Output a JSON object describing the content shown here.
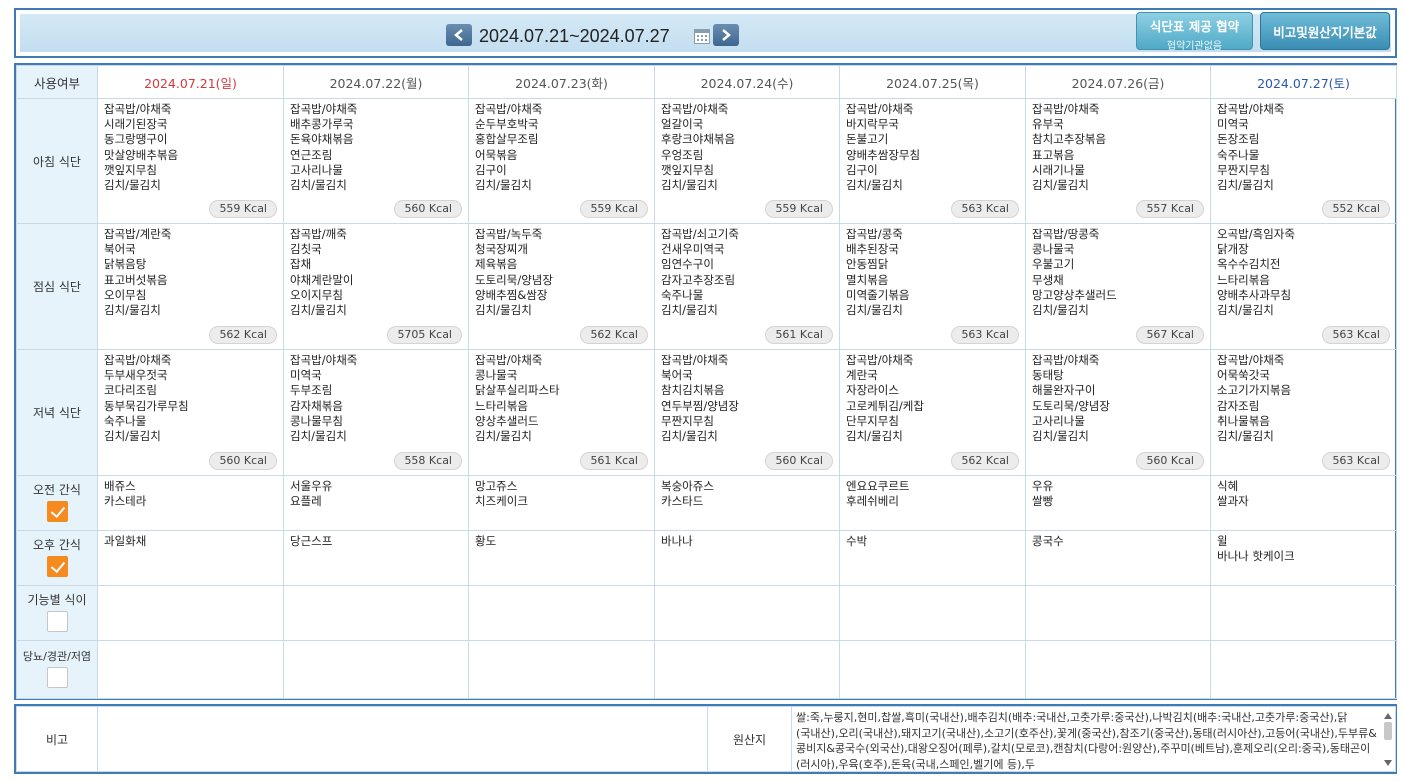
{
  "header": {
    "date_range": "2024.07.21~2024.07.27",
    "prev_label": "<",
    "next_label": ">",
    "provide_button": {
      "line1": "식단표 제공 협약",
      "line2": "협약기관없음"
    },
    "remarks_button": "비고및원산지기본값"
  },
  "table": {
    "corner_label": "사용여부",
    "days": [
      {
        "label": "2024.07.21(일)",
        "kind": "sun"
      },
      {
        "label": "2024.07.22(월)",
        "kind": "weekday"
      },
      {
        "label": "2024.07.23(화)",
        "kind": "weekday"
      },
      {
        "label": "2024.07.24(수)",
        "kind": "weekday"
      },
      {
        "label": "2024.07.25(목)",
        "kind": "weekday"
      },
      {
        "label": "2024.07.26(금)",
        "kind": "weekday"
      },
      {
        "label": "2024.07.27(토)",
        "kind": "sat"
      }
    ],
    "rows": [
      {
        "label": "아침 식단",
        "checkbox": null,
        "cells": [
          {
            "items": [
              "잡곡밥/야채죽",
              "시래기된장국",
              "동그랑땡구이",
              "맛살양배추볶음",
              "깻잎지무침",
              "김치/물김치"
            ],
            "kcal": "559 Kcal"
          },
          {
            "items": [
              "잡곡밥/야채죽",
              "배추콩가루국",
              "돈육야채볶음",
              "연근조림",
              "고사리나물",
              "김치/물김치"
            ],
            "kcal": "560 Kcal"
          },
          {
            "items": [
              "잡곡밥/야채죽",
              "순두부호박국",
              "홍합살무조림",
              "어묵볶음",
              "김구이",
              "김치/물김치"
            ],
            "kcal": "559 Kcal"
          },
          {
            "items": [
              "잡곡밥/야채죽",
              "얼갈이국",
              "후랑크야채볶음",
              "우엉조림",
              "깻잎지무침",
              "김치/물김치"
            ],
            "kcal": "559 Kcal"
          },
          {
            "items": [
              "잡곡밥/야채죽",
              "바지락무국",
              "돈불고기",
              "양배추쌈장무침",
              "김구이",
              "김치/물김치"
            ],
            "kcal": "563 Kcal"
          },
          {
            "items": [
              "잡곡밥/야채죽",
              "유부국",
              "참치고추장볶음",
              "표고볶음",
              "시래기나물",
              "김치/물김치"
            ],
            "kcal": "557 Kcal"
          },
          {
            "items": [
              "잡곡밥/야채죽",
              "미역국",
              "돈장조림",
              "숙주나물",
              "무짠지무침",
              "김치/물김치"
            ],
            "kcal": "552 Kcal"
          }
        ]
      },
      {
        "label": "점심 식단",
        "checkbox": null,
        "cells": [
          {
            "items": [
              "잡곡밥/계란죽",
              "북어국",
              "닭볶음탕",
              "표고버섯볶음",
              "오이무침",
              "김치/물김치"
            ],
            "kcal": "562 Kcal"
          },
          {
            "items": [
              "잡곡밥/깨죽",
              "김칫국",
              "잡채",
              "야채계란말이",
              "오이지무침",
              "김치/물김치"
            ],
            "kcal": "5705 Kcal"
          },
          {
            "items": [
              "잡곡밥/녹두죽",
              "청국장찌개",
              "제육볶음",
              "도토리묵/양념장",
              "양배추찜&쌈장",
              "김치/물김치"
            ],
            "kcal": "562 Kcal"
          },
          {
            "items": [
              "잡곡밥/쇠고기죽",
              "건새우미역국",
              "임연수구이",
              "감자고추장조림",
              "숙주나물",
              "김치/물김치"
            ],
            "kcal": "561 Kcal"
          },
          {
            "items": [
              "잡곡밥/콩죽",
              "배추된장국",
              "안동찜닭",
              "멸치볶음",
              "미역줄기볶음",
              "김치/물김치"
            ],
            "kcal": "563 Kcal"
          },
          {
            "items": [
              "잡곡밥/땅콩죽",
              "콩나물국",
              "우불고기",
              "무생채",
              "망고양상추샐러드",
              "김치/물김치"
            ],
            "kcal": "567 Kcal"
          },
          {
            "items": [
              "오곡밥/흑임자죽",
              "닭개장",
              "옥수수김치전",
              "느타리볶음",
              "양배추사과무침",
              "김치/물김치"
            ],
            "kcal": "563 Kcal"
          }
        ]
      },
      {
        "label": "저녁 식단",
        "checkbox": null,
        "cells": [
          {
            "items": [
              "잡곡밥/야채죽",
              "두부새우젓국",
              "코다리조림",
              "동부묵김가루무침",
              "숙주나물",
              "김치/물김치"
            ],
            "kcal": "560 Kcal"
          },
          {
            "items": [
              "잡곡밥/야채죽",
              "미역국",
              "두부조림",
              "감자채볶음",
              "콩나물무침",
              "김치/물김치"
            ],
            "kcal": "558 Kcal"
          },
          {
            "items": [
              "잡곡밥/야채죽",
              "콩나물국",
              "닭살푸실리파스타",
              "느타리볶음",
              "양상추샐러드",
              "김치/물김치"
            ],
            "kcal": "561 Kcal"
          },
          {
            "items": [
              "잡곡밥/야채죽",
              "북어국",
              "참치김치볶음",
              "연두부찜/양념장",
              "무짠지무침",
              "김치/물김치"
            ],
            "kcal": "560 Kcal"
          },
          {
            "items": [
              "잡곡밥/야채죽",
              "계란국",
              "자장라이스",
              "고로케튀김/케찹",
              "단무지무침",
              "김치/물김치"
            ],
            "kcal": "562 Kcal"
          },
          {
            "items": [
              "잡곡밥/야채죽",
              "동태탕",
              "해물완자구이",
              "도토리묵/양념장",
              "고사리나물",
              "김치/물김치"
            ],
            "kcal": "560 Kcal"
          },
          {
            "items": [
              "잡곡밥/야채죽",
              "어묵쑥갓국",
              "소고기가지볶음",
              "감자조림",
              "취나물볶음",
              "김치/물김치"
            ],
            "kcal": "563 Kcal"
          }
        ]
      },
      {
        "label": "오전 간식",
        "checkbox": true,
        "cells": [
          {
            "items": [
              "배쥬스",
              "카스테라"
            ],
            "kcal": ""
          },
          {
            "items": [
              "서울우유",
              "요플레"
            ],
            "kcal": ""
          },
          {
            "items": [
              "망고쥬스",
              "치즈케이크"
            ],
            "kcal": ""
          },
          {
            "items": [
              "복숭아쥬스",
              "카스타드"
            ],
            "kcal": ""
          },
          {
            "items": [
              "엔요요쿠르트",
              "후레쉬베리"
            ],
            "kcal": ""
          },
          {
            "items": [
              "우유",
              "쌀빵"
            ],
            "kcal": ""
          },
          {
            "items": [
              "식혜",
              "쌀과자"
            ],
            "kcal": ""
          }
        ]
      },
      {
        "label": "오후 간식",
        "checkbox": true,
        "cells": [
          {
            "items": [
              "과일화채"
            ],
            "kcal": ""
          },
          {
            "items": [
              "당근스프"
            ],
            "kcal": ""
          },
          {
            "items": [
              "황도"
            ],
            "kcal": ""
          },
          {
            "items": [
              "바나나"
            ],
            "kcal": ""
          },
          {
            "items": [
              "수박"
            ],
            "kcal": ""
          },
          {
            "items": [
              "콩국수"
            ],
            "kcal": ""
          },
          {
            "items": [
              "윌",
              "바나나 핫케이크"
            ],
            "kcal": ""
          }
        ]
      },
      {
        "label": "기능별 식이",
        "checkbox": false,
        "cells": [
          {
            "items": [],
            "kcal": ""
          },
          {
            "items": [],
            "kcal": ""
          },
          {
            "items": [],
            "kcal": ""
          },
          {
            "items": [],
            "kcal": ""
          },
          {
            "items": [],
            "kcal": ""
          },
          {
            "items": [],
            "kcal": ""
          },
          {
            "items": [],
            "kcal": ""
          }
        ]
      },
      {
        "label": "당뇨/경관/저염",
        "checkbox": false,
        "cells": [
          {
            "items": [],
            "kcal": ""
          },
          {
            "items": [],
            "kcal": ""
          },
          {
            "items": [],
            "kcal": ""
          },
          {
            "items": [],
            "kcal": ""
          },
          {
            "items": [],
            "kcal": ""
          },
          {
            "items": [],
            "kcal": ""
          },
          {
            "items": [],
            "kcal": ""
          }
        ]
      }
    ]
  },
  "footer": {
    "remarks_label": "비고",
    "remarks_value": "",
    "origin_label": "원산지",
    "origin_text": "쌀:죽,누룽지,현미,찹쌀,흑미(국내산),배추김치(배추:국내산,고춧가루:중국산),나박김치(배추:국내산,고춧가루:중국산),닭(국내산),오리(국내산),돼지고기(국내산),소고기(호주산),꽃게(중국산),참조기(중국산),동태(러시아산),고등어(국내산),두부류&콩비지&콩국수(외국산),대왕오징어(페루),갈치(모로코),캔참치(다랑어:원양산),주꾸미(베트남),훈제오리(오리:중국),동태곤이(러시아),우육(호주),돈육(국내,스페인,벨기에 등),두"
  },
  "colors": {
    "border": "#3f7cb7",
    "rowlabel_bg": "#e7f3fb",
    "sunday": "#d33a3a",
    "saturday": "#2a58b0",
    "checkbox_on": "#f58a1f"
  }
}
